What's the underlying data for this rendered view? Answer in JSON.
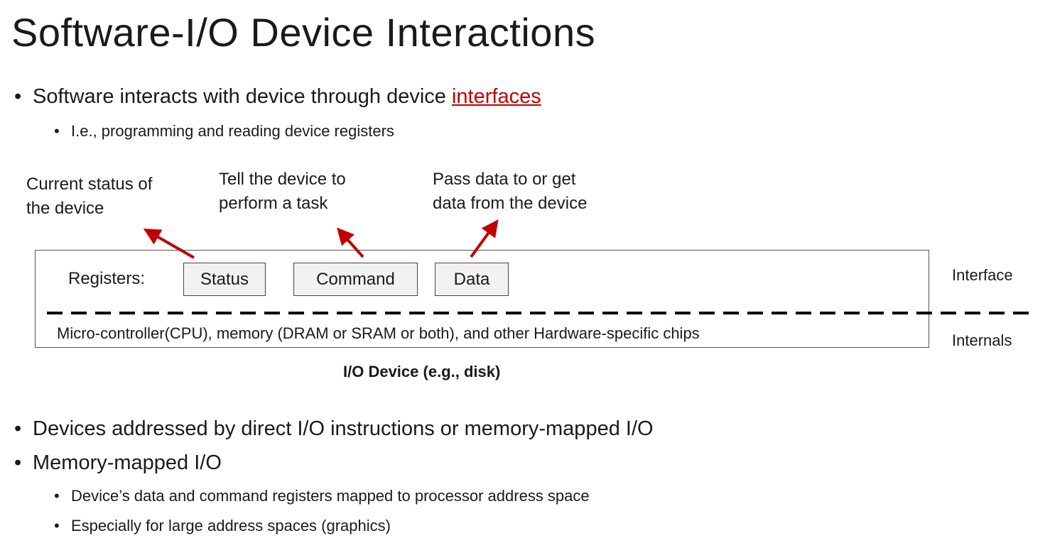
{
  "title": "Software-I/O Device Interactions",
  "bullets_top": {
    "main_prefix": "Software interacts with device through device ",
    "main_link": "interfaces",
    "sub": "I.e., programming and reading device registers"
  },
  "diagram": {
    "annotations": {
      "status": [
        "Current status of",
        "the device"
      ],
      "command": [
        "Tell the device to",
        "perform a task"
      ],
      "data": [
        "Pass data to or get",
        "data from the device"
      ]
    },
    "registers_label": "Registers:",
    "registers": [
      "Status",
      "Command",
      "Data"
    ],
    "internals_text": "Micro-controller(CPU), memory (DRAM or SRAM or both), and other Hardware-specific chips",
    "interface_label": "Interface",
    "internals_label": "Internals",
    "caption": "I/O Device (e.g., disk)",
    "colors": {
      "arrow": "#c00000",
      "link": "#c00000",
      "register_fill": "#f2f2f2"
    }
  },
  "bullets_bottom": [
    {
      "text": "Devices addressed by direct I/O instructions or memory-mapped I/O",
      "subs": []
    },
    {
      "text": "Memory-mapped I/O",
      "subs": [
        "Device’s data and command registers mapped to processor address space",
        "Especially for large address spaces (graphics)"
      ]
    }
  ]
}
